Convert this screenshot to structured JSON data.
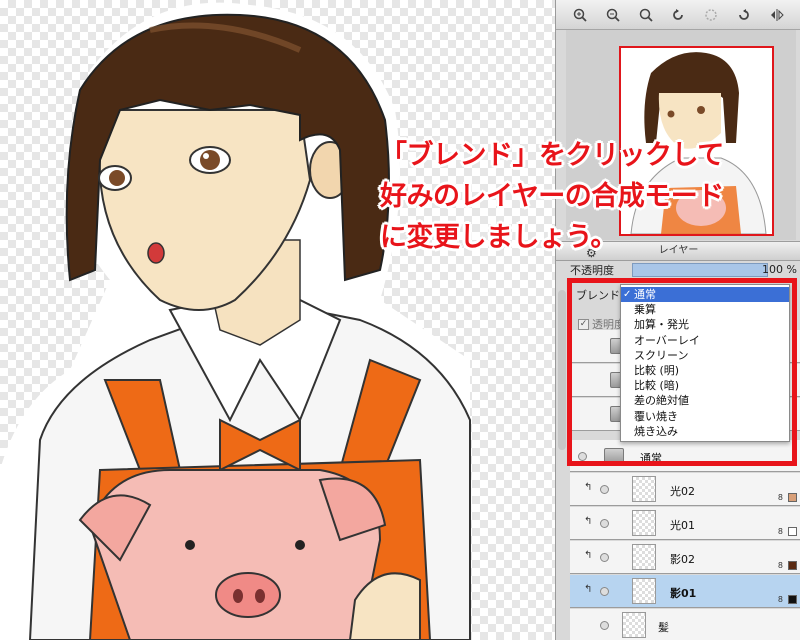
{
  "annotation": {
    "line1": "「ブレンド」をクリックして",
    "line2": "好みのレイヤーの合成モード",
    "line3": "に変更しましょう。"
  },
  "layer_panel": {
    "title": "レイヤー",
    "opacity_label": "不透明度",
    "opacity_value": "100 %",
    "blend_label": "ブレンド",
    "transparency_lock_label": "透明度",
    "folder_name": "通常"
  },
  "blend_menu": {
    "selected": "通常",
    "items": [
      "通常",
      "乗算",
      "加算・発光",
      "オーバーレイ",
      "スクリーン",
      "比較 (明)",
      "比較 (暗)",
      "差の絶対値",
      "覆い焼き",
      "焼き込み"
    ]
  },
  "layers": [
    {
      "name": "光02",
      "bit": "8",
      "swatch_color": "#d9a079",
      "selected": false
    },
    {
      "name": "光01",
      "bit": "8",
      "swatch_color": "#ffffff",
      "selected": false
    },
    {
      "name": "影02",
      "bit": "8",
      "swatch_color": "#5a2a12",
      "selected": false
    },
    {
      "name": "影01",
      "bit": "8",
      "swatch_color": "#111111",
      "selected": true
    },
    {
      "name": "髪",
      "bit": "",
      "swatch_color": "",
      "selected": false
    }
  ],
  "toolbar_icons": [
    "zoom-in-icon",
    "zoom-out-icon",
    "zoom-reset-icon",
    "rotate-left-icon",
    "rotate-reset-icon",
    "rotate-right-icon",
    "flip-horizontal-icon"
  ],
  "colors": {
    "highlight": "#e8141a",
    "menu_selection": "#3b6fd6",
    "selected_layer": "#b7d4f0"
  }
}
